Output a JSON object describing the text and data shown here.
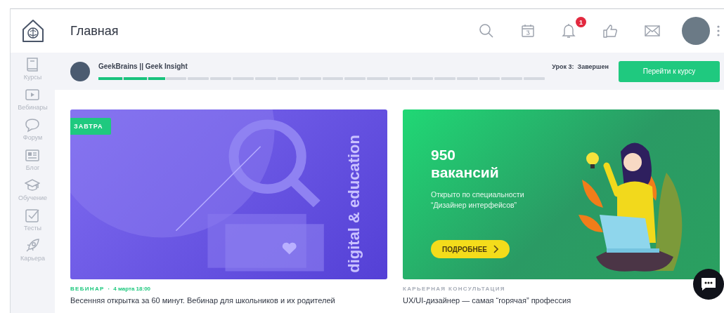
{
  "header": {
    "title": "Главная",
    "notifications_badge": "1"
  },
  "sidebar": {
    "items": [
      {
        "label": "Курсы"
      },
      {
        "label": "Вебинары"
      },
      {
        "label": "Форум"
      },
      {
        "label": "Блог"
      },
      {
        "label": "Обучение"
      },
      {
        "label": "Тесты"
      },
      {
        "label": "Карьера"
      }
    ]
  },
  "course_bar": {
    "title": "GeekBrains || Geek Insight",
    "progress": {
      "level": 0.15
    },
    "status": "Урок 3:  Завершен",
    "button": "Перейти к курсу"
  },
  "cards": [
    {
      "kind": "webinar",
      "badge": "ЗАВТРА",
      "image_text": "digital & education",
      "category": "ВЕБИНАР",
      "separator": "·",
      "date": "4 марта 18:00",
      "title": "Весенняя открытка за 60 минут. Вебинар для школьников и их родителей"
    },
    {
      "kind": "career",
      "headline_number": "950",
      "headline_word": "вакансий",
      "subtitle": "Открыто по специальности “Дизайнер интерфейсов”",
      "button": "ПОДРОБНЕЕ",
      "category": "КАРЬЕРНАЯ КОНСУЛЬТАЦИЯ",
      "title": "UX/UI-дизайнер — самая “горячая” профессия"
    }
  ]
}
